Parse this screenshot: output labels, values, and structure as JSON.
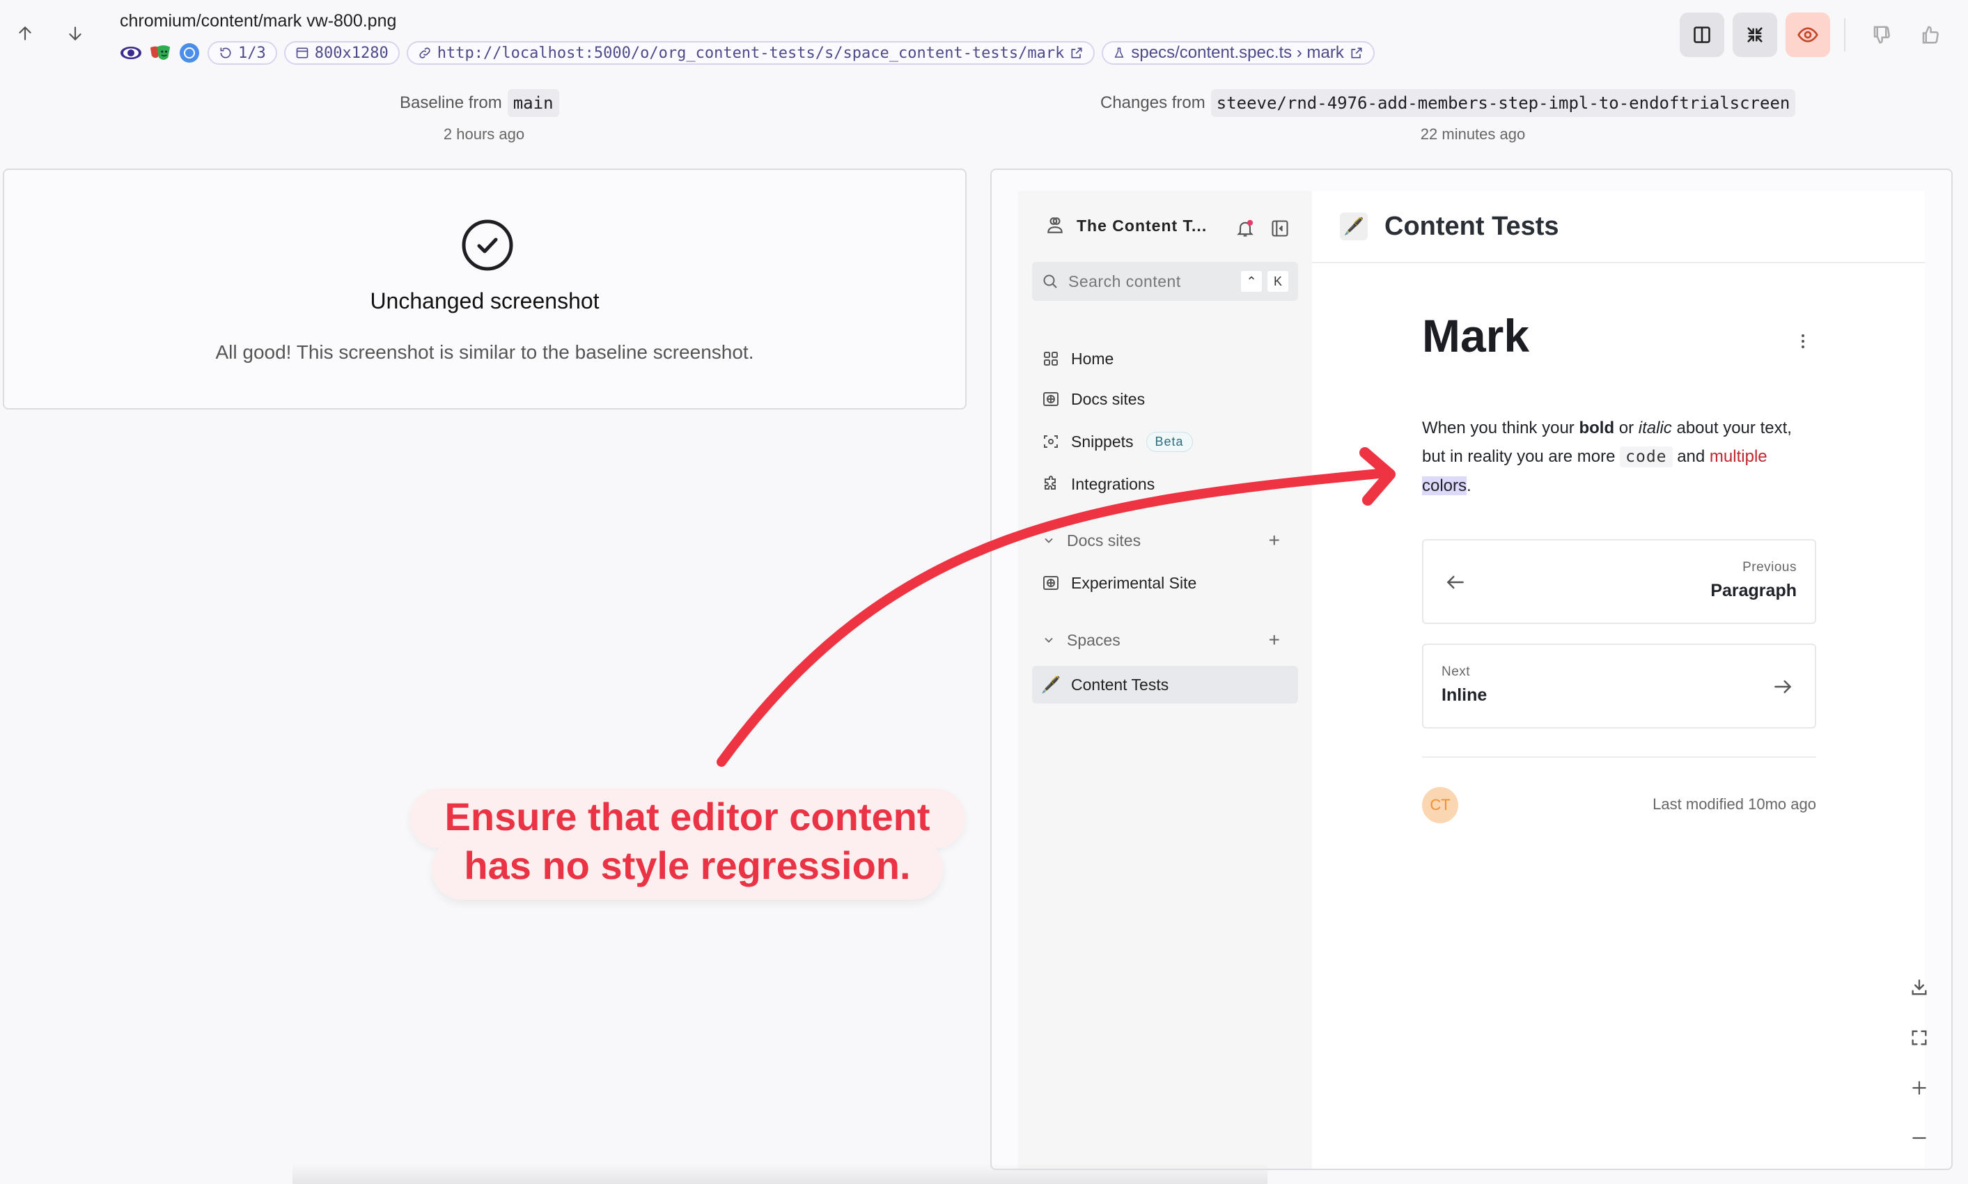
{
  "toolbar": {
    "prev_label": "previous-screenshot",
    "next_label": "next-screenshot",
    "file_title": "chromium/content/mark vw-800.png",
    "retry": "1/3",
    "viewport": "800x1280",
    "url": "http://localhost:5000/o/org_content-tests/s/space_content-tests/mark",
    "spec": "specs/content.spec.ts › mark",
    "accent_active": "#fdd5cc"
  },
  "comparison": {
    "baseline_label": "Baseline from",
    "baseline_branch": "main",
    "baseline_time": "2 hours ago",
    "changes_label": "Changes from",
    "changes_branch": "steeve/rnd-4976-add-members-step-impl-to-endoftrialscreen",
    "changes_time": "22 minutes ago"
  },
  "baseline_panel": {
    "title": "Unchanged screenshot",
    "message": "All good! This screenshot is similar to the baseline screenshot."
  },
  "app": {
    "org_name": "The Content T...",
    "search_placeholder": "Search content",
    "search_shortcut": [
      "⌃",
      "K"
    ],
    "nav": [
      {
        "label": "Home",
        "icon": "grid-icon"
      },
      {
        "label": "Docs sites",
        "icon": "globe-icon"
      },
      {
        "label": "Snippets",
        "icon": "snippet-icon",
        "badge": "Beta"
      },
      {
        "label": "Integrations",
        "icon": "puzzle-icon"
      }
    ],
    "docs_section": "Docs sites",
    "docs_items": [
      {
        "label": "Experimental Site"
      }
    ],
    "spaces_section": "Spaces",
    "space_items": [
      {
        "label": "Content Tests",
        "emoji": "🖋️",
        "active": true
      }
    ],
    "header_title": "Content Tests",
    "header_emoji": "🖋️",
    "page_title": "Mark",
    "paragraph": {
      "t1": "When you think your ",
      "bold": "bold",
      "t2": " or ",
      "italic": "italic",
      "t3": " about your text, but in reality you are more ",
      "code": "code",
      "t4": " and ",
      "red": "multiple",
      "t5": " ",
      "highlight": "colors",
      "t6": "."
    },
    "prev_card": {
      "small": "Previous",
      "title": "Paragraph"
    },
    "next_card": {
      "small": "Next",
      "title": "Inline"
    },
    "avatar_initials": "CT",
    "last_modified": "Last modified 10mo ago"
  },
  "annotation": {
    "line1": "Ensure that editor content",
    "line2": "has no style regression.",
    "color": "#ea3344"
  }
}
